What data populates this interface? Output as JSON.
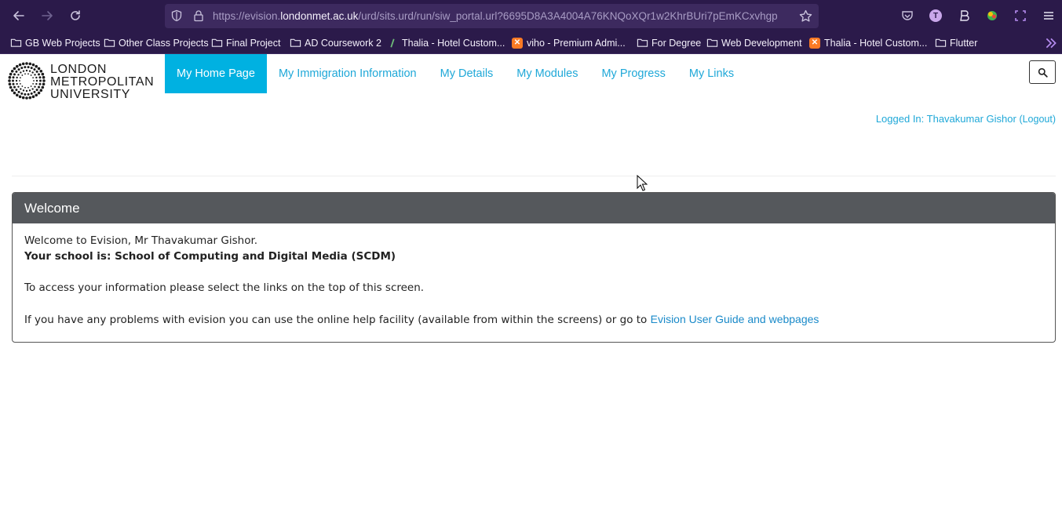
{
  "browser": {
    "url_prefix": "https://evision.",
    "url_host": "londonmet.ac.uk",
    "url_path": "/urd/sits.urd/run/siw_portal.url?6695D8A3A4004A76KNQoXQr1w2KhrBUri7pEmKCxvhgp",
    "profile_initial": "T",
    "accent": "#2b1a4a"
  },
  "bookmarks": [
    {
      "label": "GB Web Projects",
      "icon": "folder-icon"
    },
    {
      "label": "Other Class Projects",
      "icon": "folder-icon"
    },
    {
      "label": "Final Project",
      "icon": "folder-icon"
    },
    {
      "label": "AD Coursework 2",
      "icon": "folder-icon"
    },
    {
      "label": "Thalia - Hotel Custom...",
      "icon": "site-icon"
    },
    {
      "label": "viho - Premium Admi...",
      "icon": "xampp-icon"
    },
    {
      "label": "For Degree",
      "icon": "folder-icon"
    },
    {
      "label": "Web Development",
      "icon": "folder-icon"
    },
    {
      "label": "Thalia - Hotel Custom...",
      "icon": "xampp-icon"
    },
    {
      "label": "Flutter",
      "icon": "folder-icon"
    }
  ],
  "site": {
    "logo_lines": [
      "LONDON",
      "METROPOLITAN",
      "UNIVERSITY"
    ],
    "nav": [
      {
        "label": "My Home Page",
        "active": true
      },
      {
        "label": "My Immigration Information",
        "active": false
      },
      {
        "label": "My Details",
        "active": false
      },
      {
        "label": "My Modules",
        "active": false
      },
      {
        "label": "My Progress",
        "active": false
      },
      {
        "label": "My Links",
        "active": false
      }
    ],
    "logged_in_prefix": "Logged In: Thavakumar Gishor",
    "logout_label": "(Logout)",
    "accent": "#00b1e1"
  },
  "welcome": {
    "title": "Welcome",
    "greeting": "Welcome to Evision, Mr Thavakumar Gishor.",
    "school": "Your school is: School of Computing and Digital Media (SCDM)",
    "instructions": "To access your information please select the links on the top of this screen.",
    "help_text": "If you have any problems with evision you can use the online help facility (available from within the screens) or go to",
    "help_link": "Evision User Guide and webpages"
  }
}
